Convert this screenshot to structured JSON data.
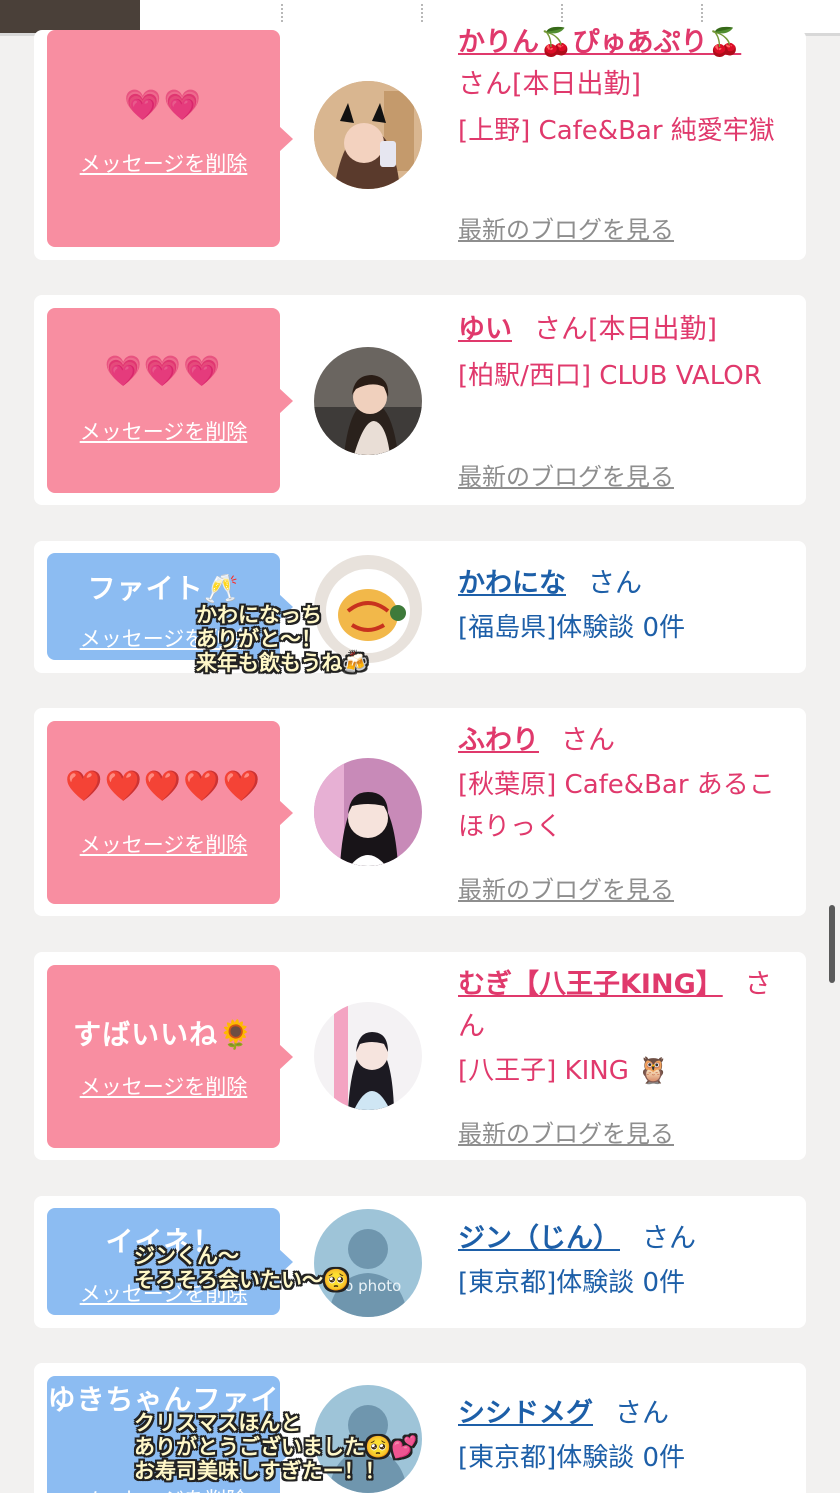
{
  "colors": {
    "pink_bubble": "#f88ea1",
    "blue_bubble": "#8cbcf2",
    "pink_text": "#e0396c",
    "blue_text": "#1d5fa8",
    "background": "#f2f1f0"
  },
  "delete_label": "メッセージを削除",
  "blog_label": "最新のブログを見る",
  "cards": [
    {
      "message": "💗💗",
      "name": "かりん🍒ぴゅあぷり🍒",
      "san": "さん[本日出勤]",
      "shop": "[上野] Cafe&Bar 純愛牢獄",
      "blog": "最新のブログを見る"
    },
    {
      "message": "💗💗💗",
      "name": "ゆい",
      "san": "さん[本日出勤]",
      "shop": "[柏駅/西口] CLUB VALOR",
      "blog": "最新のブログを見る"
    },
    {
      "message": "ファイト🥂",
      "name": "かわにな",
      "san": "さん",
      "shop": "[福島県]体験談 0件",
      "overlay": "かわになっち\nありがと〜！\n来年も飲もうね🍻"
    },
    {
      "message": "❤️❤️❤️❤️❤️",
      "name": "ふわり",
      "san": "さん",
      "shop": "[秋葉原] Cafe&Bar あるこほりっく",
      "blog": "最新のブログを見る"
    },
    {
      "message": "すばいいね🌻",
      "name": "むぎ【八王子KING】",
      "san": "さん",
      "shop": "[八王子] KING 🦉",
      "blog": "最新のブログを見る"
    },
    {
      "message": "イイネ！",
      "name": "ジン（じん）",
      "san": "さん",
      "shop": "[東京都]体験談 0件",
      "overlay": "ジンくん〜\nそろそろ会いたい〜🥺",
      "avatar_text": "no photo"
    },
    {
      "message": "ゆきちゃんファイ",
      "name": "シシドメグ",
      "san": "さん",
      "shop": "[東京都]体験談 0件",
      "overlay": "クリスマスほんと\nありがとうございました🥺💕\nお寿司美味しすぎたー！！"
    }
  ]
}
